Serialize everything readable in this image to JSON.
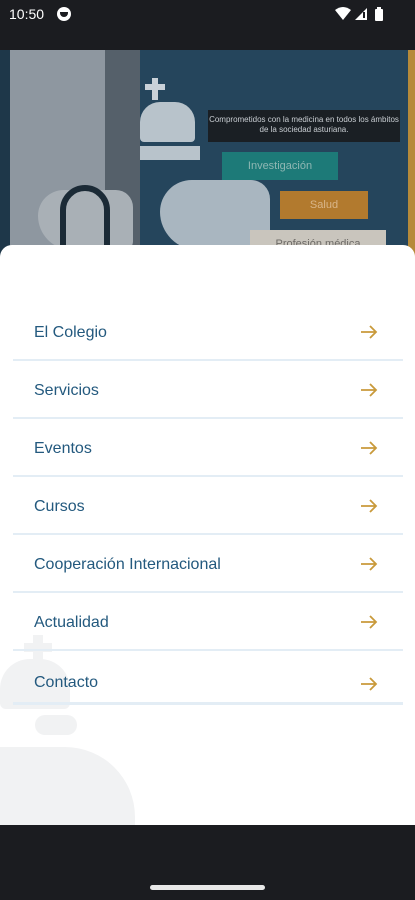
{
  "status_bar": {
    "time": "10:50",
    "icons": [
      "app-notification-icon",
      "wifi-icon",
      "cell-signal-icon",
      "battery-icon"
    ]
  },
  "hero": {
    "tagline": "Comprometidos con la medicina en todos los ámbitos de la sociedad asturiana.",
    "buttons": [
      "Investigación",
      "Salud",
      "Profesión médica"
    ]
  },
  "menu": {
    "items": [
      {
        "label": "El Colegio"
      },
      {
        "label": "Servicios"
      },
      {
        "label": "Eventos"
      },
      {
        "label": "Cursos"
      },
      {
        "label": "Cooperación Internacional"
      },
      {
        "label": "Actualidad"
      },
      {
        "label": "Contacto"
      }
    ],
    "arrow_icon": "arrow-right-icon"
  },
  "colors": {
    "menu_text": "#23597e",
    "arrow": "#c99a3b",
    "divider": "#e3edf5",
    "system_bars": "#1b1c20"
  }
}
